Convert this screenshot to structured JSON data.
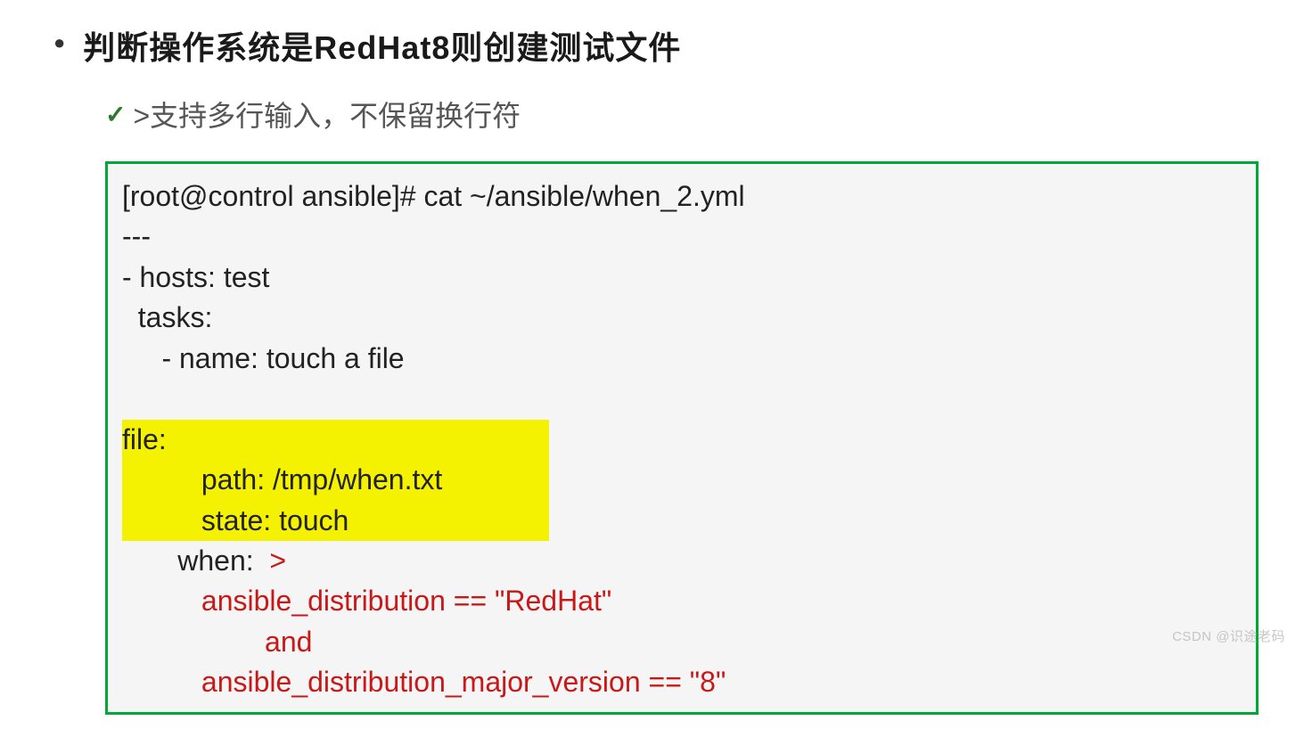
{
  "title": "判断操作系统是RedHat8则创建测试文件",
  "subtitle": ">支持多行输入，不保留换行符",
  "code": {
    "line1": "[root@control ansible]# cat ~/ansible/when_2.yml",
    "line2": "---",
    "line3": "- hosts: test",
    "line4": "  tasks:",
    "line5": "     - name: touch a file",
    "line6a": "       ",
    "line6b": "file:",
    "line7": "          path: /tmp/when.txt",
    "line8": "          state: touch",
    "line9a": "       when:  ",
    "line9b": ">",
    "line10": "          ansible_distribution == \"RedHat\"",
    "line11": "                  and",
    "line12": "          ansible_distribution_major_version == \"8\""
  },
  "watermark": "CSDN @识途老码"
}
